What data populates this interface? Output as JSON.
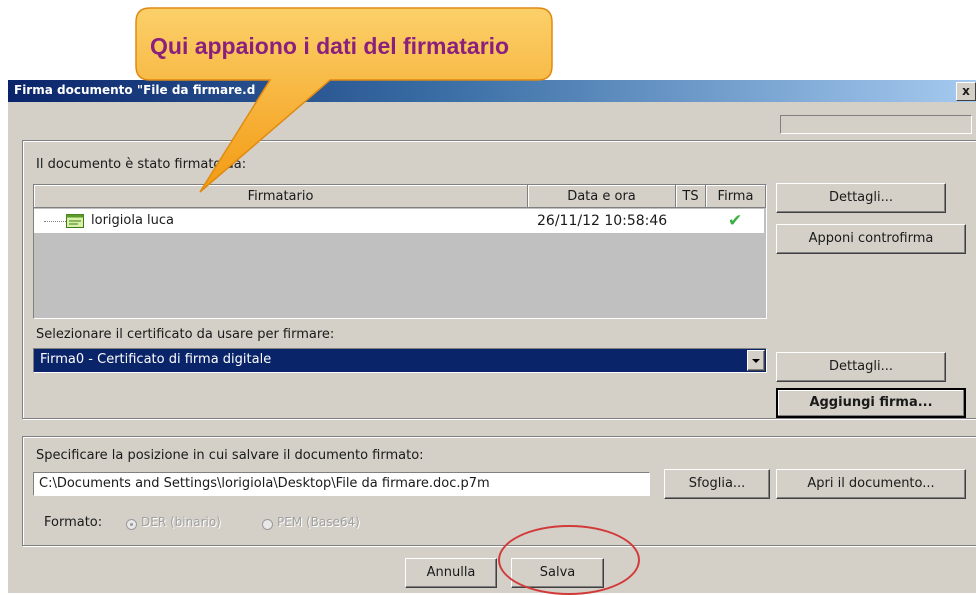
{
  "window": {
    "title": "Firma documento \"File da firmare.d",
    "close": "x"
  },
  "callout": {
    "text": "Qui appaiono i dati del firmatario"
  },
  "signers": {
    "group_label": "Il documento è stato firmato da:",
    "columns": [
      "Firmatario",
      "Data e ora",
      "TS",
      "Firma"
    ],
    "rows": [
      {
        "firmatario": "lorigiola luca",
        "data_ora": "26/11/12 10:58:46",
        "ts": "",
        "firma": "✔"
      }
    ],
    "details_button": "Dettagli...",
    "countersign_button": "Apponi controfirma"
  },
  "certificate": {
    "label": "Selezionare il certificato da usare per firmare:",
    "selected": "Firma0 - Certificato di firma digitale",
    "details_button": "Dettagli...",
    "add_signature_button": "Aggiungi firma..."
  },
  "save": {
    "label": "Specificare la posizione in cui salvare il documento firmato:",
    "path": "C:\\Documents and Settings\\lorigiola\\Desktop\\File da firmare.doc.p7m",
    "browse_button": "Sfoglia...",
    "open_button": "Apri il documento...",
    "format_label": "Formato:",
    "format_options": [
      "DER (binario)",
      "PEM (Base64)"
    ],
    "format_selected": "DER (binario)"
  },
  "footer": {
    "cancel_button": "Annulla",
    "save_button": "Salva"
  },
  "colors": {
    "title_bar": "#0a246a",
    "selection": "#0a246a",
    "callout_fill": "#f5a623",
    "callout_text": "#8a1f7e",
    "check": "#3cb043",
    "highlight_circle": "#d23a3a"
  }
}
